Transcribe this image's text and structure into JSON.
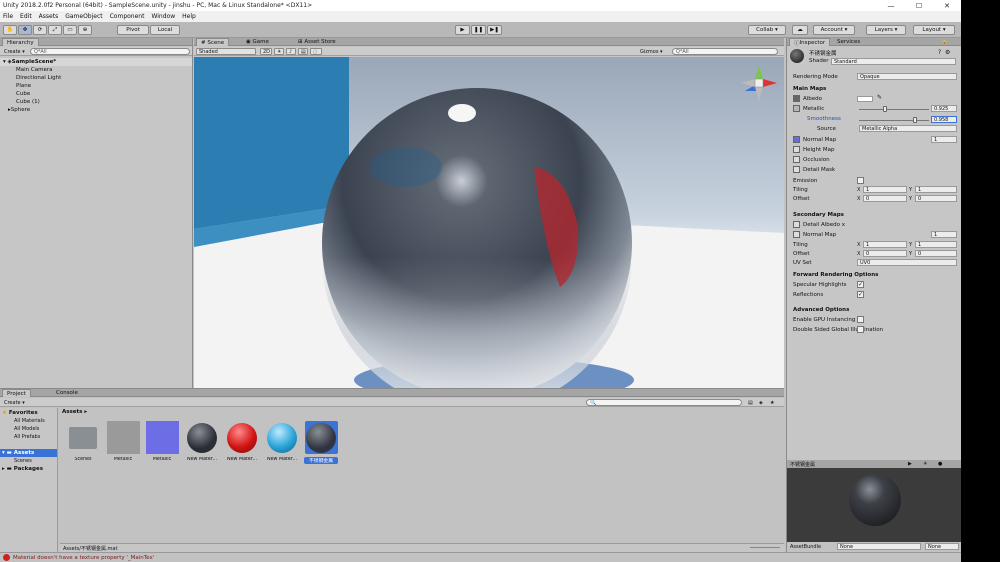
{
  "window_title": "Unity 2018.2.0f2 Personal (64bit) - SampleScene.unity - jinshu - PC, Mac & Linux Standalone* <DX11>",
  "window_controls": {
    "minimize": "—",
    "maximize": "☐",
    "close": "✕"
  },
  "menu": [
    "File",
    "Edit",
    "Assets",
    "GameObject",
    "Component",
    "Window",
    "Help"
  ],
  "toolbar": {
    "pivot": "Pivot",
    "local": "Local",
    "play": "▶",
    "pause": "❚❚",
    "step": "▶❚",
    "collab": "Collab ▾",
    "cloud": "☁",
    "account": "Account ▾",
    "layers": "Layers ▾",
    "layout": "Layout ▾"
  },
  "hierarchy": {
    "tab": "Hierarchy",
    "create": "Create ▾",
    "search_placeholder": "Q*All",
    "scene": "SampleScene*",
    "items": [
      "Main Camera",
      "Directional Light",
      "Plane",
      "Cube",
      "Cube (1)",
      "Sphere"
    ]
  },
  "scene_view": {
    "tabs": [
      "# Scene",
      "◉ Game",
      "⊞ Asset Store"
    ],
    "shading_mode": "Shaded",
    "mode_2d": "2D",
    "gizmos": "Gizmos ▾",
    "search_placeholder": "Q*All"
  },
  "project": {
    "tabs": [
      "Project",
      "Console"
    ],
    "create": "Create ▾",
    "favorites_title": "Favorites",
    "favorites": [
      "All Materials",
      "All Models",
      "All Prefabs"
    ],
    "assets_title": "Assets",
    "assets_children": [
      "Scenes"
    ],
    "packages_title": "Packages",
    "breadcrumb": "Assets ▸",
    "path": "Assets/不锈钢金属.mat",
    "assets": [
      {
        "label": "Scenes",
        "kind": "folder",
        "color": "#8a8f94"
      },
      {
        "label": "Metallic",
        "kind": "texture",
        "color": "#9a9a9a"
      },
      {
        "label": "Metallic",
        "kind": "texture",
        "color": "#6d6de6"
      },
      {
        "label": "New Mater...",
        "kind": "ball",
        "color": "#2a2d33"
      },
      {
        "label": "New Mater...",
        "kind": "ball",
        "color": "#d11414"
      },
      {
        "label": "New Mater...",
        "kind": "ball",
        "color": "#2aa3d8"
      },
      {
        "label": "不锈钢金属",
        "kind": "ball",
        "color": "#2f3440"
      }
    ]
  },
  "inspector": {
    "tabs": [
      "Inspector",
      "Services"
    ],
    "material_name": "不锈钢金属",
    "shader_label": "Shader",
    "shader_value": "Standard",
    "rendering_mode_label": "Rendering Mode",
    "rendering_mode_value": "Opaque",
    "main_maps": "Main Maps",
    "albedo": "Albedo",
    "metallic": "Metallic",
    "metallic_value": "0.925",
    "smoothness": "Smoothness",
    "smoothness_value": "0.958",
    "source_label": "Source",
    "source_value": "Metallic Alpha",
    "normal_map": "Normal Map",
    "normal_value": "1",
    "height_map": "Height Map",
    "occlusion": "Occlusion",
    "detail_mask": "Detail Mask",
    "emission": "Emission",
    "tiling": "Tiling",
    "offset": "Offset",
    "x": "X",
    "y": "Y",
    "tiling_x": "1",
    "tiling_y": "1",
    "offset_x": "0",
    "offset_y": "0",
    "secondary_maps": "Secondary Maps",
    "detail_albedo": "Detail Albedo x",
    "detail_normal": "Normal Map",
    "detail_normal_value": "1",
    "tiling2_x": "1",
    "tiling2_y": "1",
    "offset2_x": "0",
    "offset2_y": "0",
    "uv_set_label": "UV Set",
    "uv_set_value": "UV0",
    "forward_options": "Forward Rendering Options",
    "specular_highlights": "Specular Highlights",
    "reflections": "Reflections",
    "advanced_options": "Advanced Options",
    "gpu_instancing": "Enable GPU Instancing",
    "double_sided": "Double Sided Global Illumination",
    "preview_name": "不锈钢金属",
    "preview_label": "AssetBundle",
    "preview_bundle": "None",
    "preview_variant": "None",
    "check": "✓"
  },
  "status": {
    "message": "Material doesn't have a texture property '_MainTex'"
  },
  "colors": {
    "sky_top": "#9fb0c4",
    "wall": "#2f7fb0",
    "floor": "#f2f2f2",
    "accent": "#3a72d6"
  }
}
